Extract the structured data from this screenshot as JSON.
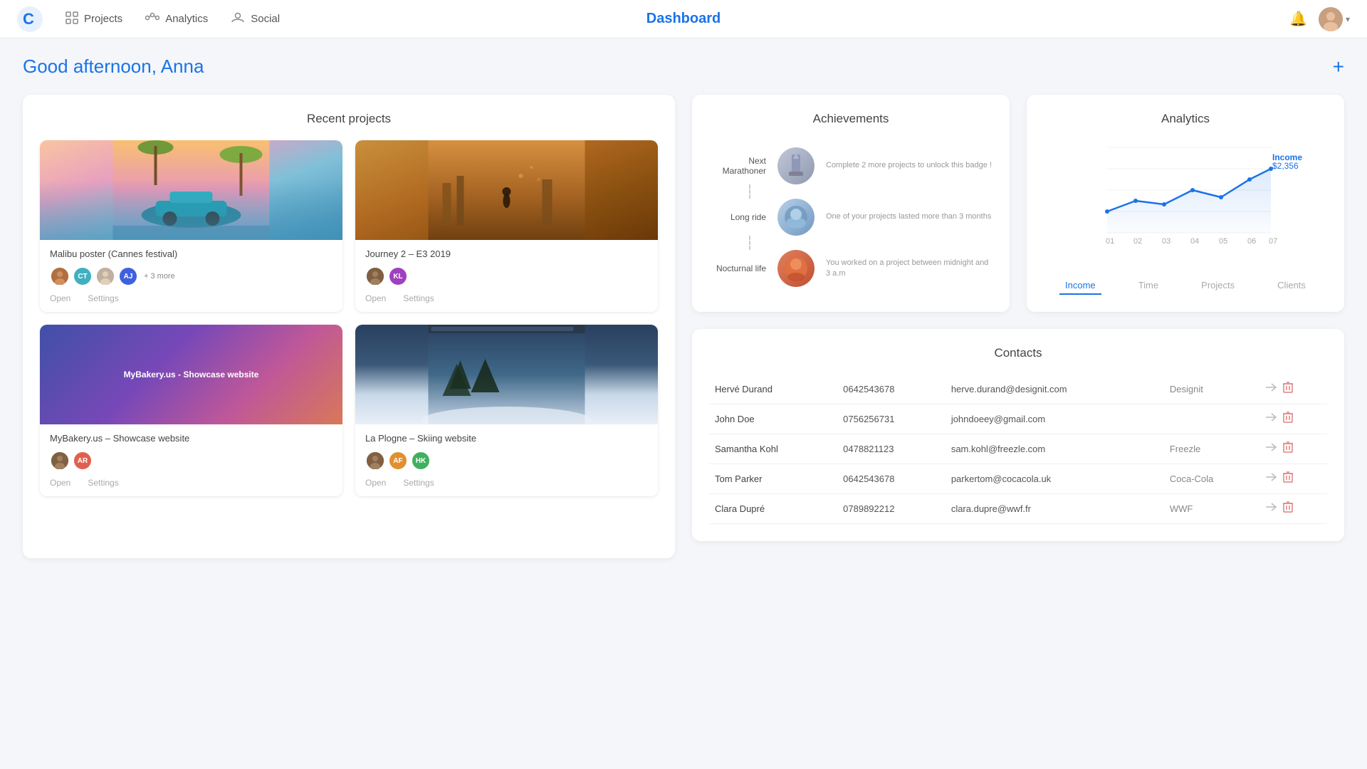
{
  "navbar": {
    "title": "Dashboard",
    "logo_alt": "C logo",
    "links": [
      {
        "label": "Projects",
        "icon": "grid-icon"
      },
      {
        "label": "Analytics",
        "icon": "analytics-icon"
      },
      {
        "label": "Social",
        "icon": "social-icon"
      }
    ],
    "bell_label": "notifications",
    "chevron_label": "▾"
  },
  "greeting": "Good afternoon, Anna",
  "add_button_label": "+",
  "recent_projects": {
    "title": "Recent projects",
    "projects": [
      {
        "id": "malibu",
        "name": "Malibu poster (Cannes festival)",
        "avatars": [
          {
            "initials": "",
            "color": "#b07040",
            "is_photo": true
          },
          {
            "initials": "CT",
            "color": "#40b0c0"
          },
          {
            "initials": "",
            "color": "#c0b0a0",
            "is_photo": true
          },
          {
            "initials": "AJ",
            "color": "#4060e0"
          }
        ],
        "more": "+ 3 more",
        "open": "Open",
        "settings": "Settings"
      },
      {
        "id": "journey",
        "name": "Journey 2 – E3 2019",
        "avatars": [
          {
            "initials": "",
            "color": "#806040",
            "is_photo": true
          },
          {
            "initials": "KL",
            "color": "#a040c0"
          }
        ],
        "more": "",
        "open": "Open",
        "settings": "Settings"
      },
      {
        "id": "bakery",
        "name": "MyBakery.us – Showcase website",
        "thumb_text": "MyBakery.us - Showcase website",
        "avatars": [
          {
            "initials": "",
            "color": "#806040",
            "is_photo": true
          },
          {
            "initials": "AR",
            "color": "#e06050"
          }
        ],
        "more": "",
        "open": "Open",
        "settings": "Settings"
      },
      {
        "id": "skiing",
        "name": "La Plogne – Skiing website",
        "avatars": [
          {
            "initials": "",
            "color": "#806040",
            "is_photo": true
          },
          {
            "initials": "AF",
            "color": "#e09030"
          },
          {
            "initials": "HK",
            "color": "#40b060"
          }
        ],
        "more": "",
        "open": "Open",
        "settings": "Settings"
      }
    ]
  },
  "achievements": {
    "title": "Achievements",
    "items": [
      {
        "label": "Next Marathoner",
        "desc": "Complete 2 more projects to unlock this badge !"
      },
      {
        "label": "Long ride",
        "desc": "One of your projects lasted more than 3 months"
      },
      {
        "label": "Nocturnal life",
        "desc": "You worked on a project between midnight and 3 a.m"
      }
    ]
  },
  "analytics": {
    "title": "Analytics",
    "income_label": "Income",
    "income_value": "$2,356",
    "x_labels": [
      "01",
      "02",
      "03",
      "04",
      "05",
      "06",
      "07"
    ],
    "tabs": [
      "Income",
      "Time",
      "Projects",
      "Clients"
    ],
    "active_tab": "Income"
  },
  "contacts": {
    "title": "Contacts",
    "rows": [
      {
        "name": "Hervé Durand",
        "phone": "0642543678",
        "email": "herve.durand@designit.com",
        "company": "Designit"
      },
      {
        "name": "John Doe",
        "phone": "0756256731",
        "email": "johndoeey@gmail.com",
        "company": ""
      },
      {
        "name": "Samantha Kohl",
        "phone": "0478821123",
        "email": "sam.kohl@freezle.com",
        "company": "Freezle"
      },
      {
        "name": "Tom Parker",
        "phone": "0642543678",
        "email": "parkertom@cocacola.uk",
        "company": "Coca-Cola"
      },
      {
        "name": "Clara Dupré",
        "phone": "0789892212",
        "email": "clara.dupre@wwf.fr",
        "company": "WWF"
      }
    ]
  }
}
